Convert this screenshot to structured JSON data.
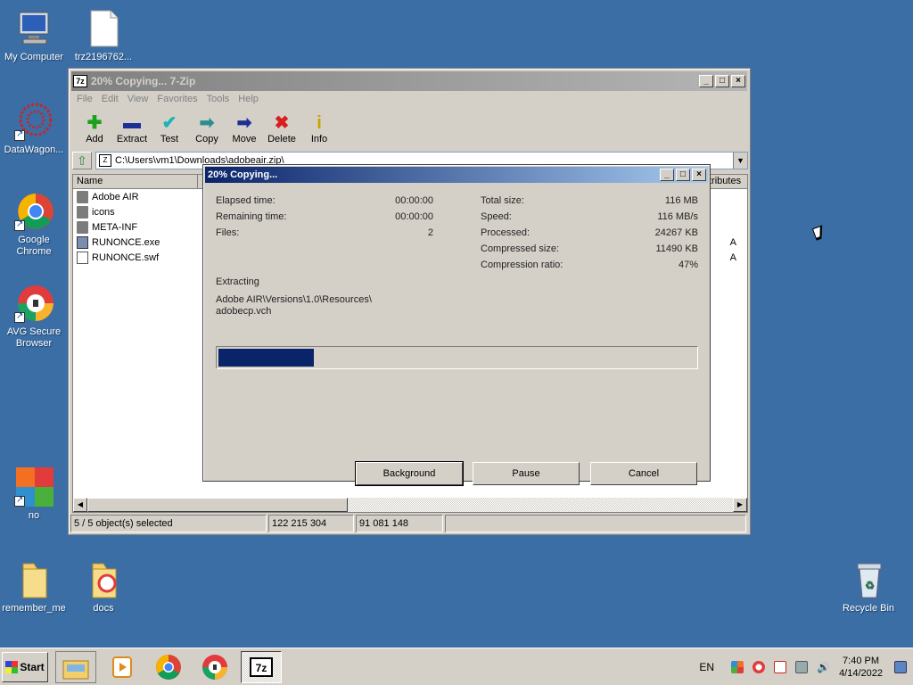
{
  "desktop": {
    "icons": [
      {
        "label": "My Computer"
      },
      {
        "label": "trz2196762..."
      },
      {
        "label": "DataWagon..."
      },
      {
        "label": "Google Chrome"
      },
      {
        "label": "AVG Secure Browser"
      },
      {
        "label": "no"
      },
      {
        "label": "remember_me"
      },
      {
        "label": "docs"
      },
      {
        "label": "Recycle Bin"
      }
    ]
  },
  "main_window": {
    "title": "20% Copying... 7-Zip",
    "app_icon_text": "7z",
    "menu": [
      "File",
      "Edit",
      "View",
      "Favorites",
      "Tools",
      "Help"
    ],
    "toolbar": [
      "Add",
      "Extract",
      "Test",
      "Copy",
      "Move",
      "Delete",
      "Info"
    ],
    "address": "C:\\Users\\vm1\\Downloads\\adobeair.zip\\",
    "columns": {
      "name": "Name",
      "attributes": "tributes"
    },
    "files": [
      {
        "name": "Adobe AIR",
        "type": "folder",
        "attr": ""
      },
      {
        "name": "icons",
        "type": "folder",
        "attr": ""
      },
      {
        "name": "META-INF",
        "type": "folder",
        "attr": ""
      },
      {
        "name": "RUNONCE.exe",
        "type": "exe",
        "attr": "A"
      },
      {
        "name": "RUNONCE.swf",
        "type": "swf",
        "attr": "A"
      }
    ],
    "status": {
      "selection": "5 / 5 object(s) selected",
      "size": "122 215 304",
      "packed": "91 081 148"
    }
  },
  "progress_dialog": {
    "title": "20% Copying...",
    "left": [
      {
        "label": "Elapsed time:",
        "value": "00:00:00"
      },
      {
        "label": "Remaining time:",
        "value": "00:00:00"
      },
      {
        "label": "Files:",
        "value": "2"
      }
    ],
    "right": [
      {
        "label": "Total size:",
        "value": "116 MB"
      },
      {
        "label": "Speed:",
        "value": "116 MB/s"
      },
      {
        "label": "Processed:",
        "value": "24267 KB"
      },
      {
        "label": "Compressed size:",
        "value": "11490 KB"
      },
      {
        "label": "Compression ratio:",
        "value": "47%"
      }
    ],
    "operation": "Extracting",
    "current_path_line1": "Adobe AIR\\Versions\\1.0\\Resources\\",
    "current_path_line2": "adobecp.vch",
    "progress_percent": 20,
    "buttons": {
      "background": "Background",
      "pause": "Pause",
      "cancel": "Cancel"
    }
  },
  "taskbar": {
    "start_label": "Start",
    "language": "EN",
    "time": "7:40 PM",
    "date": "4/14/2022"
  }
}
